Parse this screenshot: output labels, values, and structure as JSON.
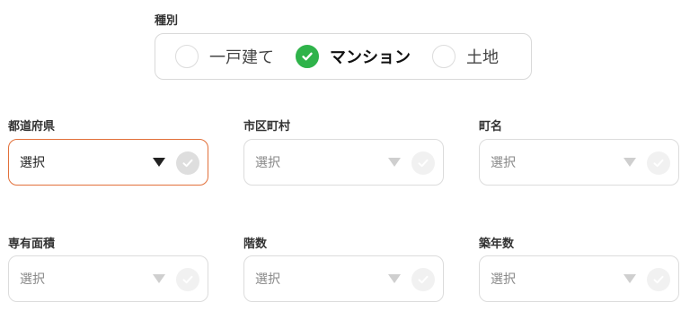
{
  "property_type": {
    "label": "種別",
    "options": [
      {
        "label": "一戸建て",
        "checked": false
      },
      {
        "label": "マンション",
        "checked": true
      },
      {
        "label": "土地",
        "checked": false
      }
    ]
  },
  "fields": {
    "prefecture": {
      "label": "都道府県",
      "value": "選択",
      "active": true
    },
    "city": {
      "label": "市区町村",
      "value": "選択",
      "active": false
    },
    "town": {
      "label": "町名",
      "value": "選択",
      "active": false
    },
    "floor_area": {
      "label": "専有面積",
      "value": "選択",
      "active": false
    },
    "floor": {
      "label": "階数",
      "value": "選択",
      "active": false
    },
    "building_age": {
      "label": "築年数",
      "value": "選択",
      "active": false
    }
  },
  "colors": {
    "accent_border": "#e2703a",
    "check_green": "#2fb34a"
  }
}
